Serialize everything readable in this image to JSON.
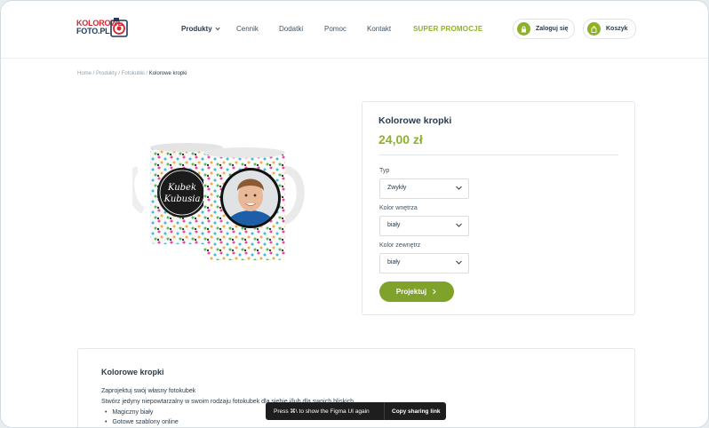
{
  "header": {
    "logo_line1": "KOLOROWE",
    "logo_line2": "FOTO.PL",
    "nav": [
      {
        "label": "Produkty"
      },
      {
        "label": "Cennik"
      },
      {
        "label": "Dodatki"
      },
      {
        "label": "Pomoc"
      },
      {
        "label": "Kontakt"
      },
      {
        "label": "SUPER PROMOCJE"
      }
    ],
    "login_label": "Zaloguj się",
    "cart_label": "Koszyk",
    "accent": "#8eb02b"
  },
  "breadcrumb": {
    "items": [
      "Home",
      "Produkty",
      "Fotokubki"
    ],
    "current": "Kolorowe kropki"
  },
  "product": {
    "image_text_1": "Kubek",
    "image_text_2": "Kubusia",
    "name": "Kolorowe kropki",
    "price": "24,00 zł",
    "fields": [
      {
        "label": "Typ",
        "value": "Zwykły"
      },
      {
        "label": "Kolor wnętrza",
        "value": "biały"
      },
      {
        "label": "Kolor zewnętrz",
        "value": "biały"
      }
    ],
    "cta_label": "Projektuj",
    "cta_icon": "chevron-right-icon"
  },
  "description": {
    "title": "Kolorowe kropki",
    "line1": "Zaprojektuj swój własny fotokubek",
    "line2": "Stwórz jedyny niepowtarzalny w swoim rodzaju fotokubek dla siebie i/lub dla swoich bliskich",
    "bullets": [
      "Magiczny biały",
      "Gotowe szablony online"
    ]
  },
  "figma_toast": {
    "hint": "Press ⌘\\ to show the Figma UI again",
    "action": "Copy sharing link"
  }
}
